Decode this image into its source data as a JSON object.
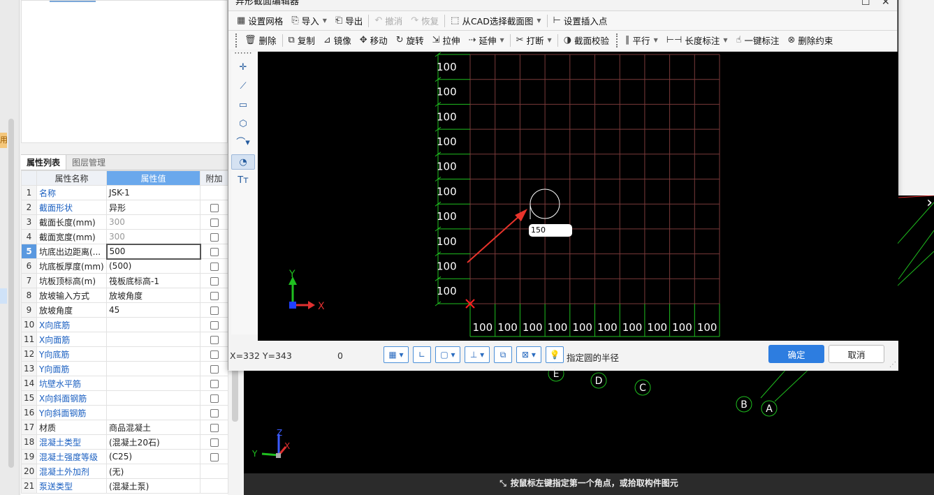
{
  "left_app": {
    "side_tag": "用",
    "panel_tabs": [
      "属性列表",
      "图层管理"
    ],
    "table_headers": {
      "name": "属性名称",
      "value": "属性值",
      "extra": "附加"
    },
    "rows": [
      {
        "num": "1",
        "name": "名称",
        "value": "JSK-1"
      },
      {
        "num": "2",
        "name": "截面形状",
        "value": "异形"
      },
      {
        "num": "3",
        "name": "截面长度(mm)",
        "value": "300"
      },
      {
        "num": "4",
        "name": "截面宽度(mm)",
        "value": "300"
      },
      {
        "num": "5",
        "name": "坑底出边距离(...",
        "value": "500"
      },
      {
        "num": "6",
        "name": "坑底板厚度(mm)",
        "value": "(500)"
      },
      {
        "num": "7",
        "name": "坑板顶标高(m)",
        "value": "筏板底标高-1"
      },
      {
        "num": "8",
        "name": "放坡输入方式",
        "value": "放坡角度"
      },
      {
        "num": "9",
        "name": "放坡角度",
        "value": "45"
      },
      {
        "num": "10",
        "name": "X向底筋",
        "value": ""
      },
      {
        "num": "11",
        "name": "X向面筋",
        "value": ""
      },
      {
        "num": "12",
        "name": "Y向底筋",
        "value": ""
      },
      {
        "num": "13",
        "name": "Y向面筋",
        "value": ""
      },
      {
        "num": "14",
        "name": "坑壁水平筋",
        "value": ""
      },
      {
        "num": "15",
        "name": "X向斜面钢筋",
        "value": ""
      },
      {
        "num": "16",
        "name": "Y向斜面钢筋",
        "value": ""
      },
      {
        "num": "17",
        "name": "材质",
        "value": "商品混凝土"
      },
      {
        "num": "18",
        "name": "混凝土类型",
        "value": "(混凝土20石)"
      },
      {
        "num": "19",
        "name": "混凝土强度等级",
        "value": "(C25)"
      },
      {
        "num": "20",
        "name": "混凝土外加剂",
        "value": "(无)"
      },
      {
        "num": "21",
        "name": "泵送类型",
        "value": "(混凝土泵)"
      }
    ]
  },
  "background_cad": {
    "axis_labels": [
      "E",
      "D",
      "C",
      "B",
      "A"
    ],
    "axis_x": "X",
    "axis_y": "Y",
    "axis_z": "Z",
    "status_hint": "按鼠标左键指定第一个角点，或拾取构件图元"
  },
  "dialog": {
    "title": "异形截面编辑器",
    "toolbar1": [
      {
        "label": "设置网格",
        "icon": "grid-icon"
      },
      {
        "label": "导入",
        "icon": "import-icon",
        "dropdown": true
      },
      {
        "label": "导出",
        "icon": "export-icon"
      },
      {
        "label": "撤消",
        "icon": "undo-icon",
        "disabled": true
      },
      {
        "label": "恢复",
        "icon": "redo-icon",
        "disabled": true
      },
      {
        "label": "从CAD选择截面图",
        "icon": "cad-select-icon",
        "dropdown": true
      },
      {
        "label": "设置插入点",
        "icon": "insert-point-icon"
      }
    ],
    "toolbar2": [
      {
        "label": "删除",
        "icon": "delete-icon"
      },
      {
        "label": "复制",
        "icon": "copy-icon"
      },
      {
        "label": "镜像",
        "icon": "mirror-icon"
      },
      {
        "label": "移动",
        "icon": "move-icon"
      },
      {
        "label": "旋转",
        "icon": "rotate-icon"
      },
      {
        "label": "拉伸",
        "icon": "stretch-icon"
      },
      {
        "label": "延伸",
        "icon": "extend-icon",
        "dropdown": true
      },
      {
        "label": "打断",
        "icon": "break-icon",
        "dropdown": true
      },
      {
        "label": "截面校验",
        "icon": "check-icon"
      },
      {
        "label": "平行",
        "icon": "parallel-icon",
        "dropdown": true
      },
      {
        "label": "长度标注",
        "icon": "dimension-icon",
        "dropdown": true
      },
      {
        "label": "一键标注",
        "icon": "auto-dimension-icon"
      },
      {
        "label": "删除约束",
        "icon": "delete-constraint-icon"
      }
    ],
    "grid_row_labels": [
      "100",
      "100",
      "100",
      "100",
      "100",
      "100",
      "100",
      "100",
      "100",
      "100"
    ],
    "grid_col_labels": [
      "100",
      "100",
      "100",
      "100",
      "100",
      "100",
      "100",
      "100",
      "100",
      "100"
    ],
    "radius_input_value": "150",
    "axis_x": "X",
    "axis_y": "Y",
    "status": {
      "coord": "X=332 Y=343",
      "zero": "0",
      "prompt": "指定圆的半径",
      "ok": "确定",
      "cancel": "取消"
    },
    "colors": {
      "grid_line": "#7a3a3a",
      "dim_line": "#1fbf1f",
      "arrow": "#e8332b",
      "primary": "#2d7de0"
    }
  }
}
